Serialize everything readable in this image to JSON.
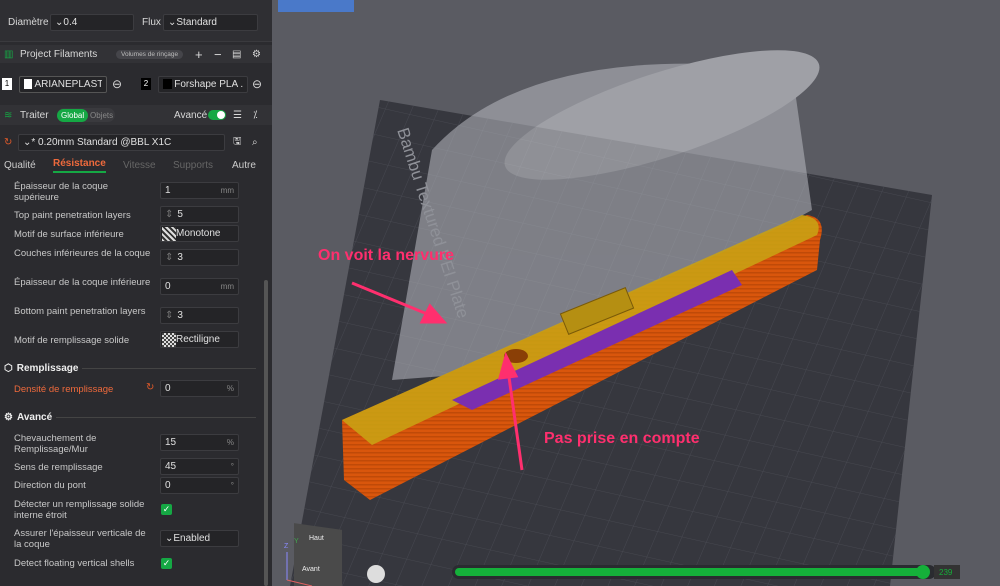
{
  "nozzle": {
    "diameter_label": "Diamètre",
    "diameter_value": "0.4",
    "flux_label": "Flux",
    "flux_value": "Standard"
  },
  "filaments": {
    "title": "Project Filaments",
    "flush_button": "Volumes de rinçage",
    "items": [
      {
        "index": "1",
        "name": "ARIANEPLAST ...",
        "color": "#ffffff"
      },
      {
        "index": "2",
        "name": "Forshape PLA ...",
        "color": "#000000"
      }
    ]
  },
  "process": {
    "title": "Traiter",
    "global": "Global",
    "objects": "Objets",
    "advanced_label": "Avancé",
    "preset": "* 0.20mm Standard @BBL X1C"
  },
  "tabs": [
    "Qualité",
    "Résistance",
    "Vitesse",
    "Supports",
    "Autre"
  ],
  "settings": [
    {
      "label": "Épaisseur de la coque supérieure",
      "value": "1",
      "unit": "mm"
    },
    {
      "label": "Top paint penetration layers",
      "value": "5"
    },
    {
      "label": "Motif de surface inférieure",
      "value": "Monotone"
    },
    {
      "label": "Couches inférieures de la coque",
      "value": "3"
    },
    {
      "label": "Épaisseur de la coque inférieure",
      "value": "0",
      "unit": "mm"
    },
    {
      "label": "Bottom paint penetration layers",
      "value": "3"
    },
    {
      "label": "Motif de remplissage solide",
      "value": "Rectiligne"
    }
  ],
  "infill": {
    "title": "Remplissage",
    "density_label": "Densité de remplissage",
    "density_value": "0",
    "unit": "%"
  },
  "advanced": {
    "title": "Avancé",
    "items": [
      {
        "label": "Chevauchement de Remplissage/Mur",
        "value": "15",
        "unit": "%"
      },
      {
        "label": "Sens de remplissage",
        "value": "45",
        "unit": "°"
      },
      {
        "label": "Direction du pont",
        "value": "0",
        "unit": "°"
      },
      {
        "label": "Détecter un remplissage solide interne étroit",
        "check": "✓"
      },
      {
        "label": "Assurer l'épaisseur verticale de la coque",
        "value": "Enabled"
      },
      {
        "label": "Detect floating vertical shells",
        "check": "✓"
      }
    ]
  },
  "viewport": {
    "plate_label": "Bambu Textured PEI Plate",
    "annotation_1": "On voit la nervure",
    "annotation_2": "Pas prise en compte",
    "cube_top": "Haut",
    "cube_front": "Avant",
    "axis_z": "Z",
    "axis_y": "Y",
    "layer_value": "239",
    "layer_progress": 1.0
  }
}
